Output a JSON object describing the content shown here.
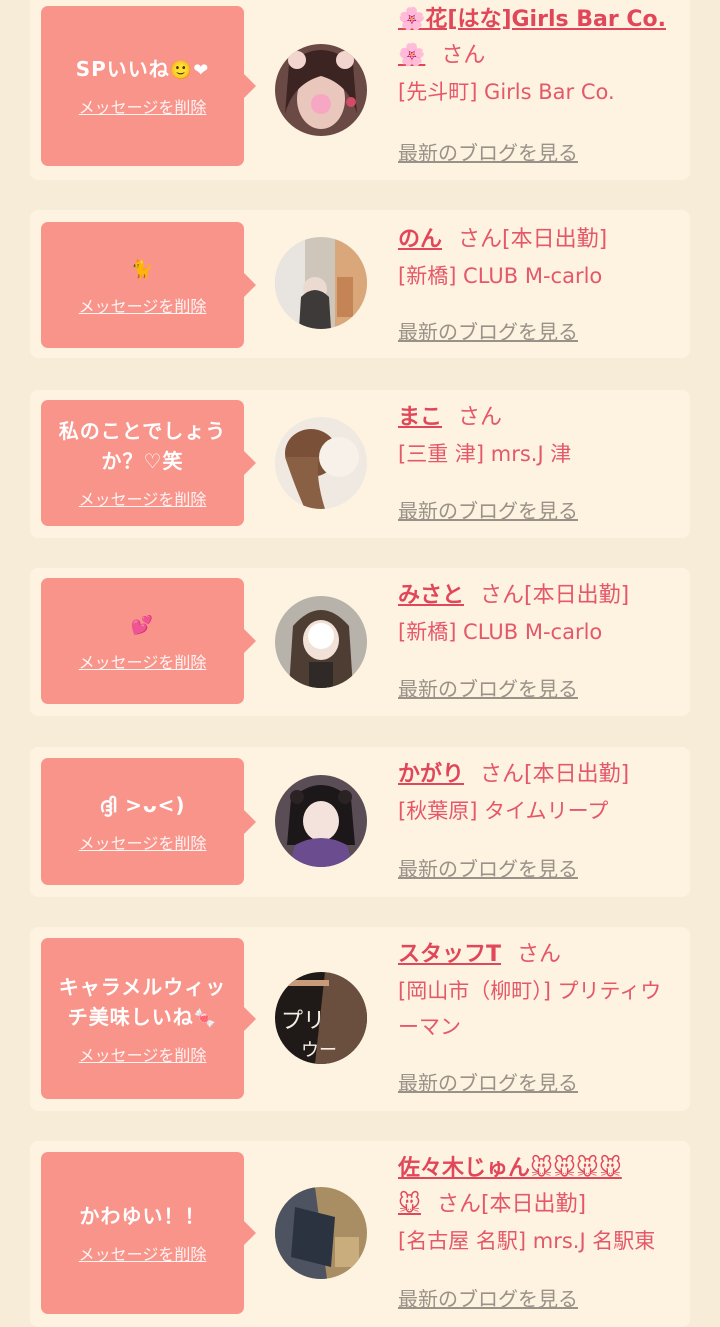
{
  "cards": [
    {
      "message": "SPいいね",
      "message_emoji": "🙂❤",
      "delete_label": "メッセージを削除",
      "name": "🌸花[はな]Girls Bar Co.",
      "name_cont": "🌸",
      "san": "さん",
      "store": "[先斗町] Girls Bar Co.",
      "blog_label": "最新のブログを見る"
    },
    {
      "message": "",
      "message_emoji": "🐈",
      "delete_label": "メッセージを削除",
      "name": "のん",
      "san": "さん[本日出勤]",
      "store": "[新橋] CLUB M-carlo",
      "blog_label": "最新のブログを見る"
    },
    {
      "message": "私のことでしょうか？♡笑",
      "message_emoji": "",
      "delete_label": "メッセージを削除",
      "name": "まこ",
      "san": "さん",
      "store": "[三重 津] mrs.J 津",
      "blog_label": "最新のブログを見る"
    },
    {
      "message": "",
      "message_emoji": "💕",
      "delete_label": "メッセージを削除",
      "name": "みさと",
      "san": "さん[本日出勤]",
      "store": "[新橋] CLUB M-carlo",
      "blog_label": "最新のブログを見る"
    },
    {
      "message": "ദ്ദി >ᴗ<)",
      "message_emoji": "",
      "delete_label": "メッセージを削除",
      "name": "かがり",
      "san": "さん[本日出勤]",
      "store": "[秋葉原] タイムリープ",
      "blog_label": "最新のブログを見る"
    },
    {
      "message": "キャラメルウィッチ美味しいね",
      "message_emoji": "🍬",
      "delete_label": "メッセージを削除",
      "name": "スタッフT",
      "san": "さん",
      "store": "[岡山市（柳町）] プリティウーマン",
      "blog_label": "最新のブログを見る"
    },
    {
      "message": "かわゆい！！",
      "message_emoji": "",
      "delete_label": "メッセージを削除",
      "name": "佐々木じゅん🐭🐭🐭🐭",
      "name_cont": "🐭",
      "san": "さん[本日出勤]",
      "store": "[名古屋 名駅] mrs.J 名駅東",
      "blog_label": "最新のブログを見る"
    }
  ],
  "colors": {
    "page_bg": "#f7ecd7",
    "card_bg": "#fdf3e0",
    "bubble": "#f9948a",
    "name": "#e1475a",
    "link_gray": "#9a9289"
  }
}
